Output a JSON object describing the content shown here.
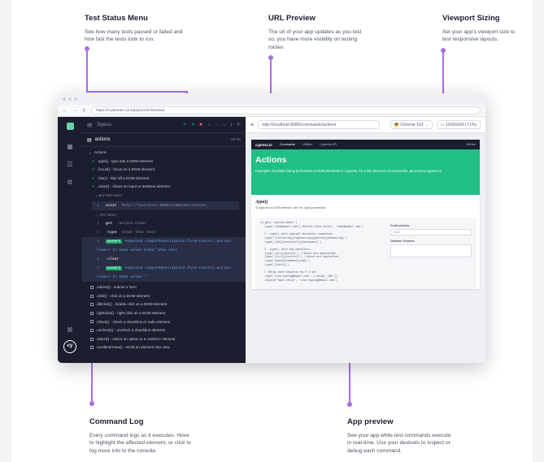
{
  "callouts": {
    "status_menu": {
      "title": "Test  Status Menu",
      "text": "See how many tests passed or failed and how fast the tests took to run."
    },
    "url_preview": {
      "title": "URL Preview",
      "text": "The url of your app updates as you test so, you have more visibility on testing routes"
    },
    "viewport": {
      "title": "Viewport Sizing",
      "text": "Set your app's viewport size to test responsive layouts."
    },
    "command_log": {
      "title": "Command Log",
      "text": "Every command logs as it executes. Hove to highlight the affected element, or click to log more info to the console."
    },
    "app_preview": {
      "title": "App preview",
      "text": "See your app while test commands execute in real-time. Use your devtools to inspect or debug each command."
    }
  },
  "browser": {
    "url": "https://customer.com/payment/checkout",
    "back": "←",
    "forward": "→",
    "reload": "↻"
  },
  "reporter": {
    "header": "Specs",
    "passed": "4",
    "failed": "--",
    "pending": "--",
    "spec_file": "actions",
    "spec_time": "00:05",
    "suite": "Actions",
    "tests_passed": [
      ".type() - type into a DOM element",
      ".focus() - focus on a DOM element",
      ".blur() - blur off a DOM element",
      ".clear() - clears an input or textarea element"
    ],
    "before_each": "BEFORE EACH",
    "visit_cmd": {
      "num": "1",
      "name": "visit",
      "arg": "http://localhost:8080/commands/actions"
    },
    "test_body": "TEST BODY",
    "body_cmds": [
      {
        "num": "1",
        "name": "get",
        "arg": ".action-clear"
      },
      {
        "num": "2",
        "name": "-type",
        "arg": "Clear this text"
      },
      {
        "num": "3",
        "badge": "assert",
        "text": "expected <input#description.form-control.action-clear> to have value Clear this text"
      },
      {
        "num": "4",
        "name": "-clear",
        "arg": ""
      },
      {
        "num": "5",
        "badge": "assert",
        "text": "expected <input#description.form-control.action-clear> to have value ''"
      }
    ],
    "tests_pending": [
      ".submit() - submit a form",
      ".click() - click on a DOM element",
      ".dblclick() - double click on a DOM element",
      ".rightclick() - right click on a DOM element",
      ".check() - check a checkbox or radio element",
      ".uncheck() - uncheck a checkbox element",
      ".select() - select an option in a <select> element",
      ".scrollIntoView() - scroll an element into view"
    ]
  },
  "aut": {
    "url": "http://localhost:8080/commands/actions",
    "browser": "Chrome 102",
    "viewport": "1000x660 (71%)"
  },
  "app": {
    "brand": "cypress.io",
    "nav": [
      "Commands",
      "Utilities",
      "Cypress API"
    ],
    "nav_right": "GitHub",
    "title": "Actions",
    "intro": "Examples of actions being performed on DOM elements in Cypress, for a full reference of commands, go to docs.cypress.io",
    "section_title": ".type()",
    "section_desc": "To type into a DOM element, use the .type() command.",
    "code": "cy.get('.action-email')\n  .type('fake@email.com').should('have.value', 'fake@email.com')\n\n  // .type() with special character sequences\n  .type('{leftarrow}{rightarrow}{uparrow}{downarrow}')\n  .type('{del}{selectall}{backspace}')\n\n  // .type() with key modifiers\n  .type('{alt}{option}') //these are equivalent\n  .type('{ctrl}{control}') //these are equivalent\n  .type('{meta}{command}{cmd}')\n  .type('{shift}')\n\n  // Delay each keypress by 0.1 sec\n  .type('slow.typing@email.com', { delay: 100 })\n  .should('have.value', 'slow.typing@email.com')",
    "email_label": "Email address",
    "email_placeholder": "email",
    "disabled_label": "Disabled Textarea"
  },
  "colors": {
    "accent": "#a96ee6",
    "pass": "#1fa971",
    "reporter_bg": "#1b1e2e",
    "hero": "#1fbf85"
  }
}
